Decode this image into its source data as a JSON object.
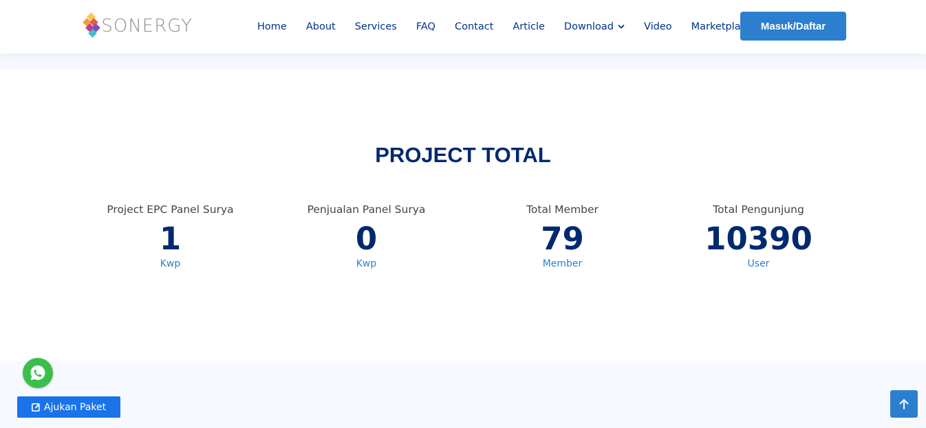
{
  "header": {
    "logo_text": "SONERGY",
    "nav": [
      {
        "label": "Home"
      },
      {
        "label": "About"
      },
      {
        "label": "Services"
      },
      {
        "label": "FAQ"
      },
      {
        "label": "Contact"
      },
      {
        "label": "Article"
      },
      {
        "label": "Download",
        "icon": "chevron-down-icon"
      },
      {
        "label": "Video"
      },
      {
        "label": "Marketplace"
      }
    ],
    "login_label": "Masuk/Daftar"
  },
  "project_total": {
    "title": "PROJECT TOTAL",
    "stats": [
      {
        "label": "Project EPC Panel Surya",
        "value": "1",
        "unit": "Kwp"
      },
      {
        "label": "Penjualan Panel Surya",
        "value": "0",
        "unit": "Kwp"
      },
      {
        "label": "Total Member",
        "value": "79",
        "unit": "Member"
      },
      {
        "label": "Total Pengunjung",
        "value": "10390",
        "unit": "User"
      }
    ]
  },
  "floating": {
    "whatsapp_icon": "whatsapp-icon",
    "ajukan_label": "Ajukan Paket",
    "ajukan_icon": "edit-icon",
    "back_to_top_icon": "arrow-up-icon"
  },
  "colors": {
    "primary_dark": "#012970",
    "accent": "#2b7fce",
    "whatsapp": "#3bbf4b",
    "ajukan": "#1a73e8"
  }
}
